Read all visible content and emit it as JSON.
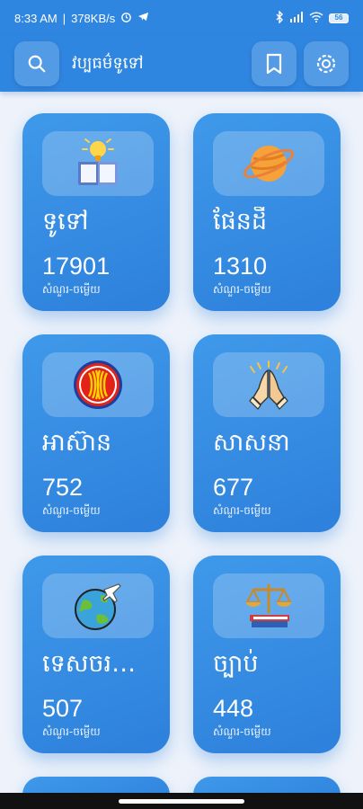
{
  "status_bar": {
    "time": "8:33 AM",
    "network_speed": "378KB/s",
    "battery": "56"
  },
  "app_bar": {
    "title": "វប្បធម៌ទូទៅ",
    "search_icon": "search-icon",
    "bookmark_icon": "bookmark-icon",
    "settings_icon": "settings-icon"
  },
  "categories": [
    {
      "name": "ទូទៅ",
      "count": "17901",
      "sub": "សំណួរ-ចម្លើយ",
      "icon": "book-lightbulb-icon"
    },
    {
      "name": "ផែនដី",
      "count": "1310",
      "sub": "សំណួរ-ចម្លើយ",
      "icon": "planet-icon"
    },
    {
      "name": "អាស៊ាន",
      "count": "752",
      "sub": "សំណួរ-ចម្លើយ",
      "icon": "asean-emblem-icon"
    },
    {
      "name": "សាសនា",
      "count": "677",
      "sub": "សំណួរ-ចម្លើយ",
      "icon": "praying-hands-icon"
    },
    {
      "name": "ទេសចរណ៍...",
      "count": "507",
      "sub": "សំណួរ-ចម្លើយ",
      "icon": "globe-plane-icon"
    },
    {
      "name": "ច្បាប់",
      "count": "448",
      "sub": "សំណួរ-ចម្លើយ",
      "icon": "law-scales-icon"
    }
  ],
  "colors": {
    "primary": "#2f86e0",
    "card": "#3a92e6"
  }
}
